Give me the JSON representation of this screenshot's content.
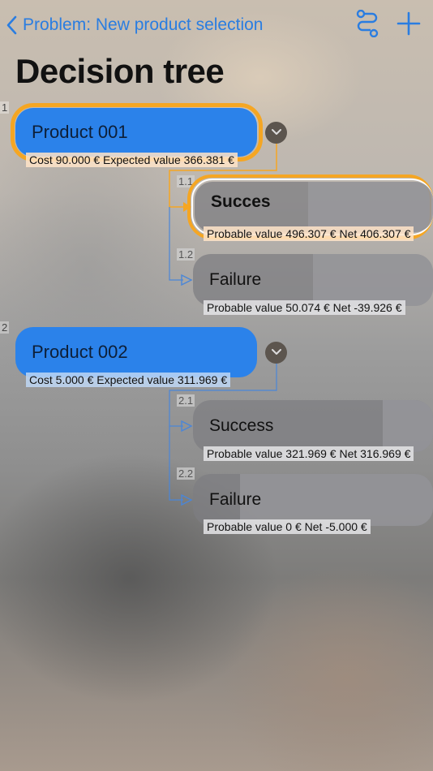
{
  "nav": {
    "back_label": "Problem: New product selection",
    "actions": [
      {
        "icon": "route-icon"
      },
      {
        "icon": "plus-icon"
      }
    ]
  },
  "title": "Decision tree",
  "colors": {
    "accent": "#2a7de1",
    "highlight": "#f5a623",
    "node_blue": "#2b82ea"
  },
  "tree": [
    {
      "index": "1",
      "label": "Product 001",
      "info": "Cost 90.000 € Expected value 366.381 €",
      "children": [
        {
          "index": "1.1",
          "label": "Succes",
          "info": "Probable value 496.307 € Net 406.307 €"
        },
        {
          "index": "1.2",
          "label": "Failure",
          "info": "Probable value 50.074 € Net -39.926 €"
        }
      ]
    },
    {
      "index": "2",
      "label": "Product 002",
      "info": "Cost 5.000 € Expected value 311.969 €",
      "children": [
        {
          "index": "2.1",
          "label": "Success",
          "info": "Probable value 321.969 € Net 316.969 €"
        },
        {
          "index": "2.2",
          "label": "Failure",
          "info": "Probable value 0 € Net -5.000 €"
        }
      ]
    }
  ]
}
